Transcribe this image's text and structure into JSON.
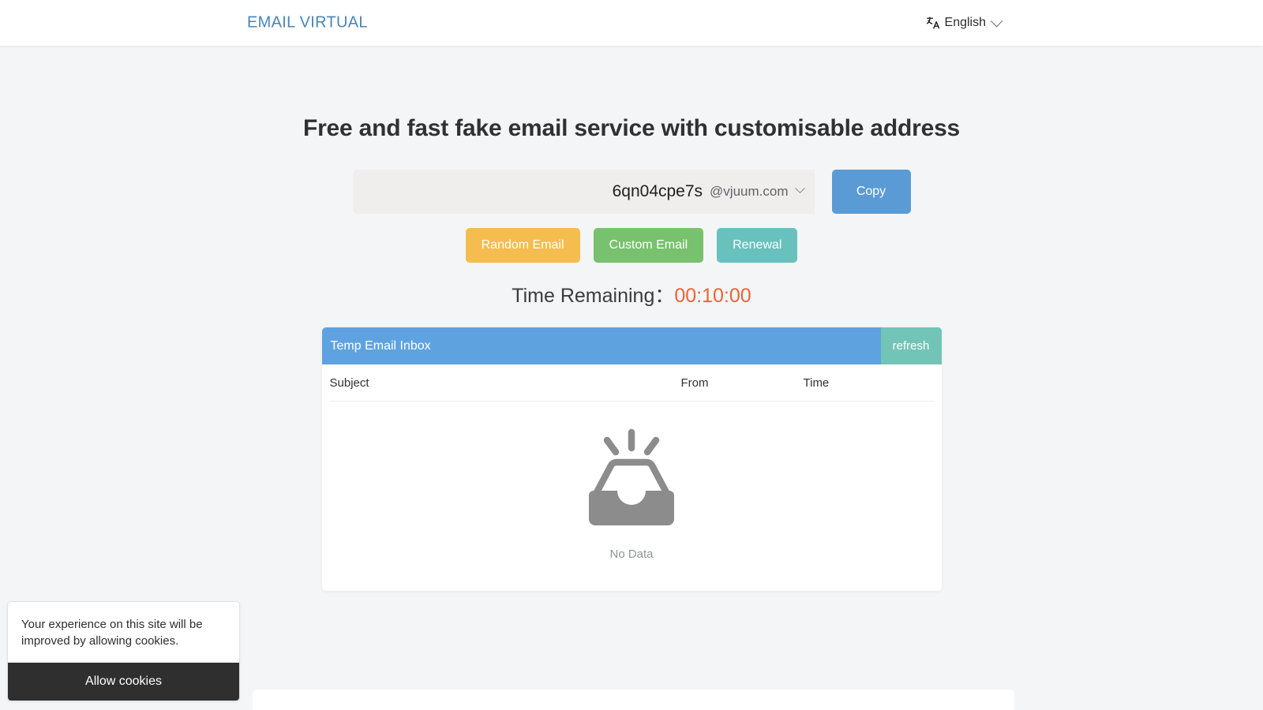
{
  "header": {
    "brand": "EMAIL VIRTUAL",
    "language": {
      "label": "English",
      "icon": "translate-icon",
      "chevron": "chevron-down-icon"
    }
  },
  "main": {
    "title": "Free and fast fake email service with customisable address",
    "email": {
      "username": "6qn04cpe7s",
      "domain": "@vjuum.com",
      "domain_chevron": "chevron-down-icon",
      "copy_label": "Copy"
    },
    "actions": [
      {
        "label": "Random Email",
        "color": "#f5bd4f"
      },
      {
        "label": "Custom Email",
        "color": "#78c16e"
      },
      {
        "label": "Renewal",
        "color": "#68c1bd"
      }
    ],
    "timer": {
      "label": "Time Remaining：",
      "value": "00:10:00",
      "value_color": "#e8653a"
    },
    "inbox": {
      "title": "Temp Email Inbox",
      "refresh_label": "refresh",
      "header_color": "#5fa2e0",
      "refresh_color": "#72c4b6",
      "columns": [
        "Subject",
        "From",
        "Time"
      ],
      "rows": [],
      "empty_state": {
        "icon": "empty-inbox-tray-icon",
        "label": "No Data"
      }
    }
  },
  "cookie_banner": {
    "message": "Your experience on this site will be improved by allowing cookies.",
    "accept_label": "Allow cookies"
  }
}
